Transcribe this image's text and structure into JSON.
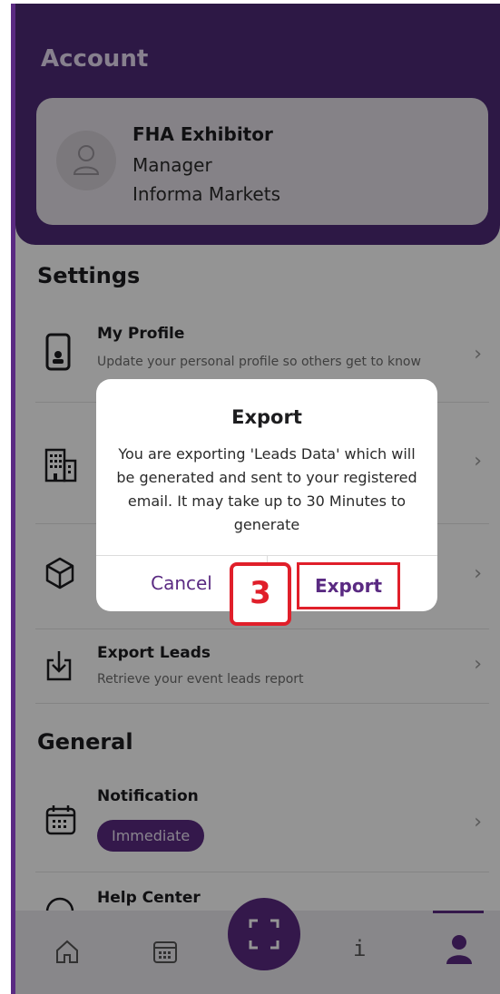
{
  "header": {
    "title": "Account"
  },
  "profile": {
    "name": "FHA Exhibitor",
    "role": "Manager",
    "company": "Informa Markets"
  },
  "settings": {
    "title": "Settings",
    "items": [
      {
        "title": "My Profile",
        "subtitle": "Update your personal profile so others get to know you better",
        "icon": "phone-icon"
      },
      {
        "title": "",
        "subtitle": "",
        "icon": "building-icon"
      },
      {
        "title": "",
        "subtitle": "",
        "icon": "cube-icon"
      },
      {
        "title": "Export Leads",
        "subtitle": "Retrieve your event leads report",
        "icon": "download-icon"
      }
    ]
  },
  "general": {
    "title": "General",
    "items": [
      {
        "title": "Notification",
        "pill": "Immediate",
        "icon": "calendar-icon"
      },
      {
        "title": "Help Center",
        "icon": "question-icon"
      }
    ]
  },
  "tabbar": {
    "items": [
      "home-icon",
      "calendar-icon",
      "scan-icon",
      "info-icon",
      "person-icon"
    ],
    "active": "person-icon",
    "info_glyph": "i"
  },
  "dialog": {
    "title": "Export",
    "message": "You are exporting 'Leads Data' which will be generated and sent to your registered email. It may take up to 30 Minutes to generate",
    "cancel_label": "Cancel",
    "export_label": "Export"
  },
  "annotation": {
    "step": "3"
  },
  "colors": {
    "primary": "#5a2a82",
    "highlight": "#e01f2a"
  }
}
